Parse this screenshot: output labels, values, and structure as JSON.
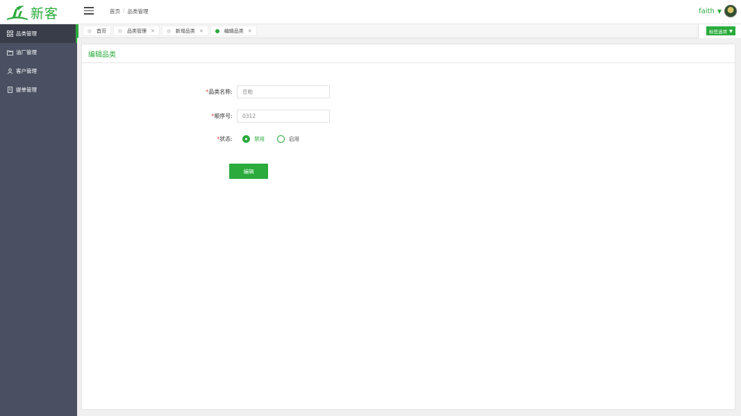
{
  "app": {
    "logo_text": "新客"
  },
  "header": {
    "breadcrumb": [
      "首页",
      "品类管理"
    ],
    "user_name": "faith"
  },
  "sidebar": {
    "items": [
      {
        "label": "品类管理",
        "icon": "grid-icon"
      },
      {
        "label": "油厂管理",
        "icon": "factory-icon"
      },
      {
        "label": "客户管理",
        "icon": "users-icon"
      },
      {
        "label": "提单管理",
        "icon": "document-icon"
      }
    ]
  },
  "tabs": {
    "items": [
      {
        "label": "首页"
      },
      {
        "label": "品类管理"
      },
      {
        "label": "新增品类"
      },
      {
        "label": "编辑品类"
      }
    ],
    "options_label": "标签选项"
  },
  "form": {
    "title": "编辑品类",
    "name_label": "品类名称:",
    "name_value": "豆粕",
    "order_label": "顺序号:",
    "order_value": "0312",
    "status_label": "状态:",
    "status_options": [
      "禁用",
      "启用"
    ],
    "required_mark": "*",
    "submit_label": "编辑"
  },
  "colors": {
    "accent": "#2aab3c",
    "sidebar": "#4a5062",
    "sidebar_active": "#393d49"
  }
}
